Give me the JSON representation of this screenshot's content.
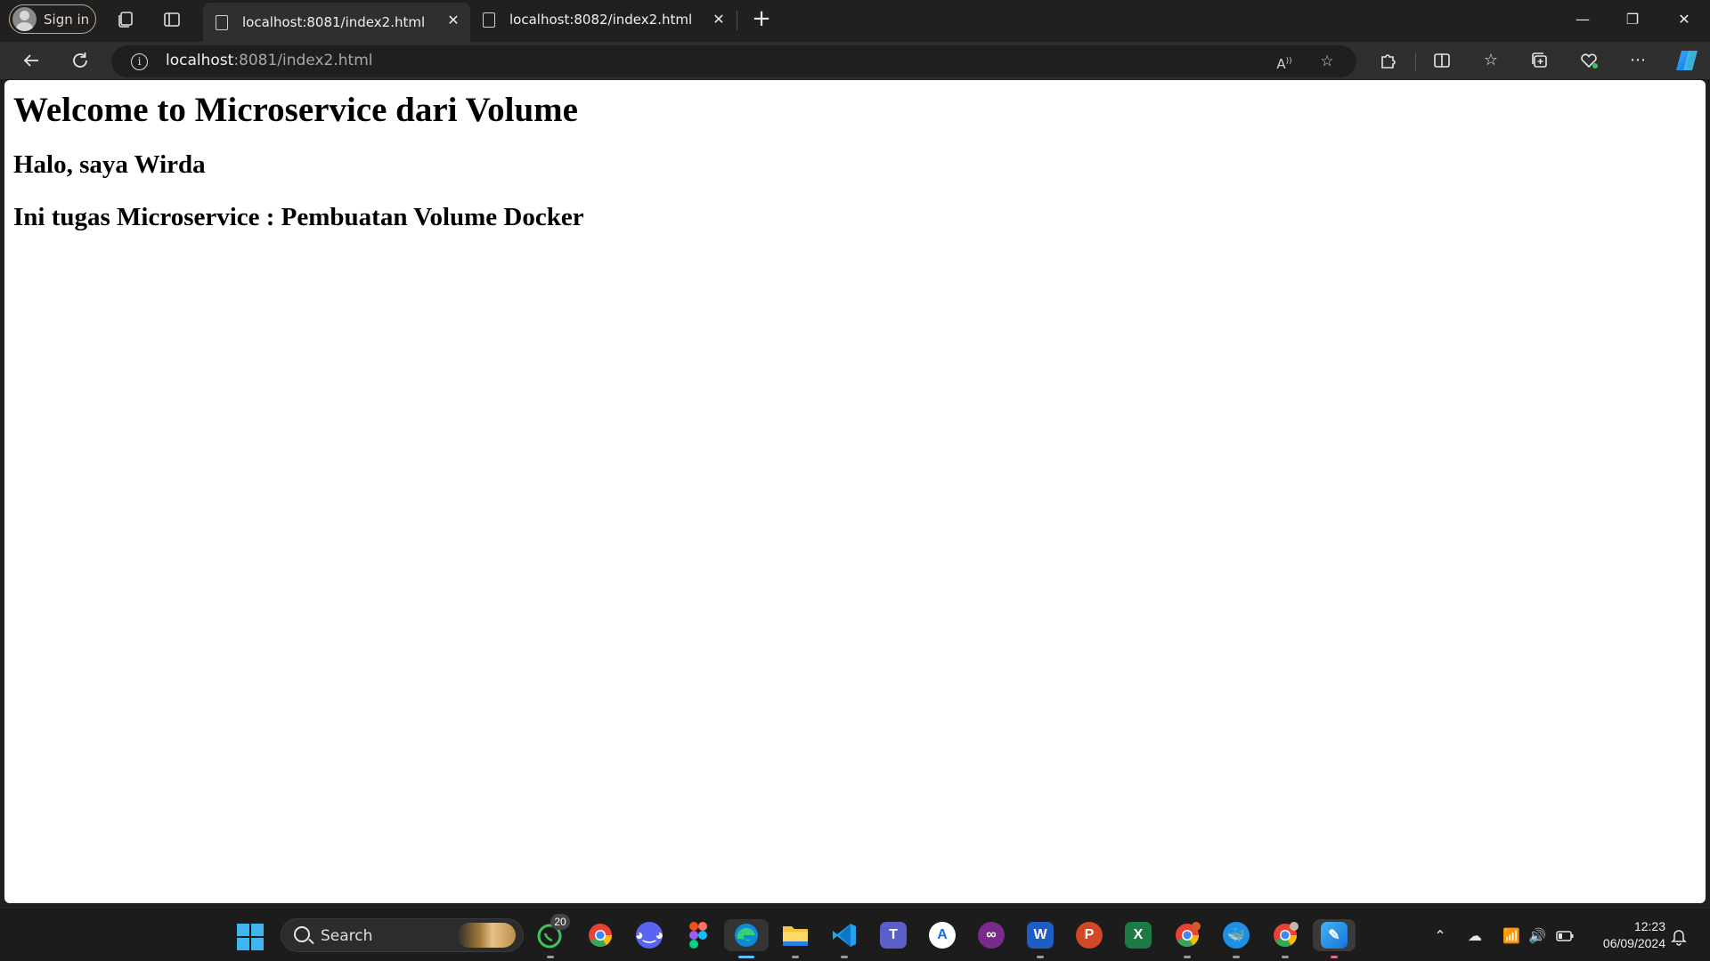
{
  "browser": {
    "signin_label": "Sign in",
    "tabs": [
      {
        "title": "localhost:8081/index2.html",
        "active": true
      },
      {
        "title": "localhost:8082/index2.html",
        "active": false
      }
    ],
    "address": {
      "host": "localhost",
      "rest": ":8081/index2.html"
    },
    "icons": {
      "workspaces": "workspaces-icon",
      "tab_actions": "tab-actions-icon",
      "back": "back-arrow-icon",
      "refresh": "refresh-icon",
      "read_aloud": "read-aloud-icon",
      "favorite": "star-icon",
      "extensions": "extensions-icon",
      "split_screen": "split-screen-icon",
      "favorites": "favorites-icon",
      "collections": "collections-icon",
      "performance": "heart-pulse-icon",
      "more": "more-icon",
      "copilot": "copilot-icon"
    }
  },
  "page": {
    "heading": "Welcome to Microservice dari Volume",
    "subheading_1": "Halo, saya Wirda",
    "subheading_2": "Ini tugas Microservice : Pembuatan Volume Docker"
  },
  "taskbar": {
    "search_label": "Search",
    "whatsapp_badge": "20",
    "clock_time": "12:23",
    "clock_date": "06/09/2024",
    "accent": "#60c0ff"
  }
}
